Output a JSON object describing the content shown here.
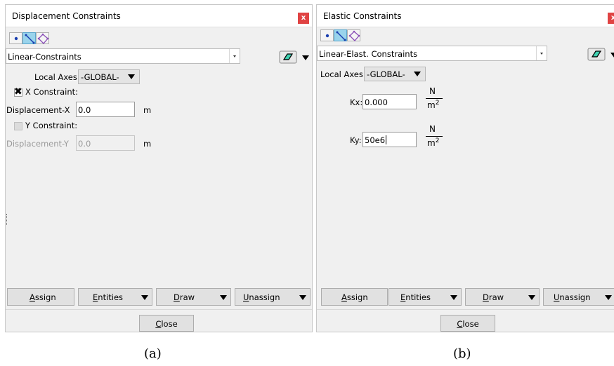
{
  "panel_a": {
    "title": "Displacement Constraints",
    "close_x": "x",
    "constraint_type": "Linear-Constraints",
    "local_axes_label": "Local Axes",
    "local_axes_value": "-GLOBAL-",
    "x_constraint": {
      "label": "X Constraint:",
      "checked": true,
      "checkmark": "✖"
    },
    "displacement_x": {
      "label": "Displacement-X",
      "value": "0.0",
      "unit": "m"
    },
    "y_constraint": {
      "label": "Y Constraint:",
      "checked": false
    },
    "displacement_y": {
      "label": "Displacement-Y",
      "value": "0.0",
      "unit": "m"
    },
    "buttons": {
      "assign_u": "A",
      "assign_rest": "ssign",
      "entities_u": "E",
      "entities_rest": "ntities",
      "draw_u": "D",
      "draw_rest": "raw",
      "unassign_u": "U",
      "unassign_rest": "nassign"
    },
    "close_u": "C",
    "close_rest": "lose"
  },
  "panel_b": {
    "title": "Elastic Constraints",
    "close_x": "x",
    "constraint_type": "Linear-Elast. Constraints",
    "local_axes_label": "Local Axes",
    "local_axes_value": "-GLOBAL-",
    "kx": {
      "label": "Kx:",
      "value": "0.000",
      "unit_num": "N",
      "unit_den": "m",
      "unit_exp": "2"
    },
    "ky": {
      "label": "Ky:",
      "value": "50e6",
      "unit_num": "N",
      "unit_den": "m",
      "unit_exp": "2"
    },
    "buttons": {
      "assign_u": "A",
      "assign_rest": "ssign",
      "entities_u": "E",
      "entities_rest": "ntities",
      "draw_u": "D",
      "draw_rest": "raw",
      "unassign_u": "U",
      "unassign_rest": "nassign"
    },
    "close_u": "C",
    "close_rest": "lose"
  },
  "captions": {
    "a": "(a)",
    "b": "(b)"
  },
  "colors": {
    "active_tool": "#9ad4ec",
    "close_x": "#e04343",
    "panel_bg": "#f0f0f0"
  },
  "icons": [
    "point-icon",
    "line-icon",
    "surface-icon",
    "eraser-icon",
    "dropdown-arrow-icon"
  ]
}
